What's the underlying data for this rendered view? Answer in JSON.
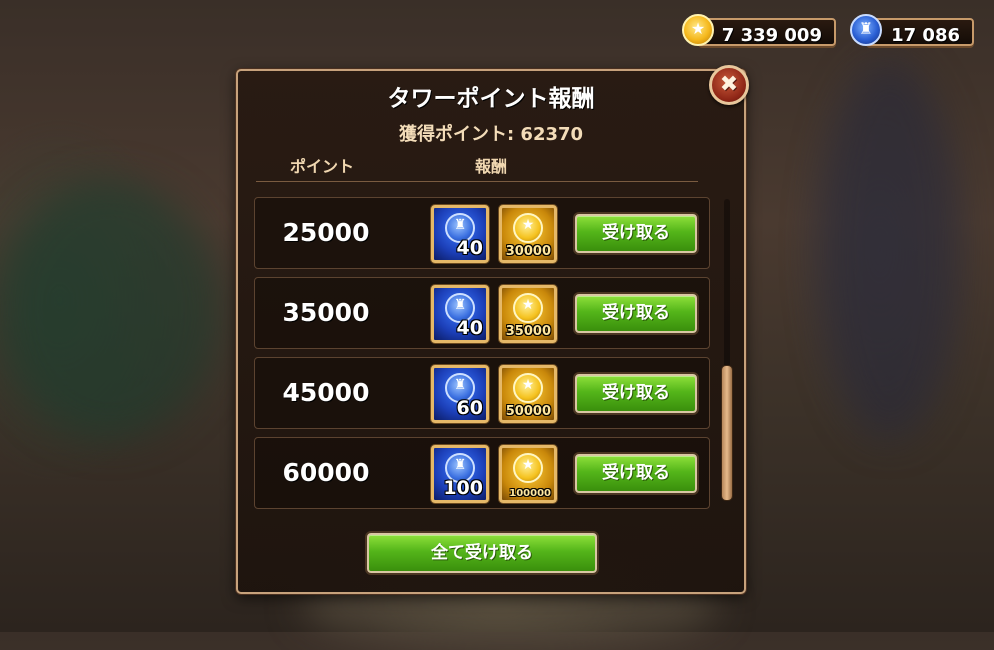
{
  "currency": {
    "gold": {
      "value": "7 339 009",
      "icon": "gold-coin-icon"
    },
    "tower_points": {
      "value": "17 086",
      "icon": "tower-point-icon"
    }
  },
  "dialog": {
    "title": "タワーポイント報酬",
    "earned_label": "獲得ポイント: 62370",
    "col_points": "ポイント",
    "col_reward": "報酬",
    "close_icon": "close-x-icon",
    "close_glyph": "✖",
    "claim_all_label": "全て受け取る"
  },
  "rewards": [
    {
      "points": "25000",
      "tower_qty": "40",
      "gold_qty": "30000",
      "claim_label": "受け取る"
    },
    {
      "points": "35000",
      "tower_qty": "40",
      "gold_qty": "35000",
      "claim_label": "受け取る"
    },
    {
      "points": "45000",
      "tower_qty": "60",
      "gold_qty": "50000",
      "claim_label": "受け取る"
    },
    {
      "points": "60000",
      "tower_qty": "100",
      "gold_qty": "100000",
      "claim_label": "受け取る"
    }
  ],
  "colors": {
    "claim_button": "#54b51a",
    "panel_border": "#c7a27c",
    "item_frame": "#e5b868"
  }
}
